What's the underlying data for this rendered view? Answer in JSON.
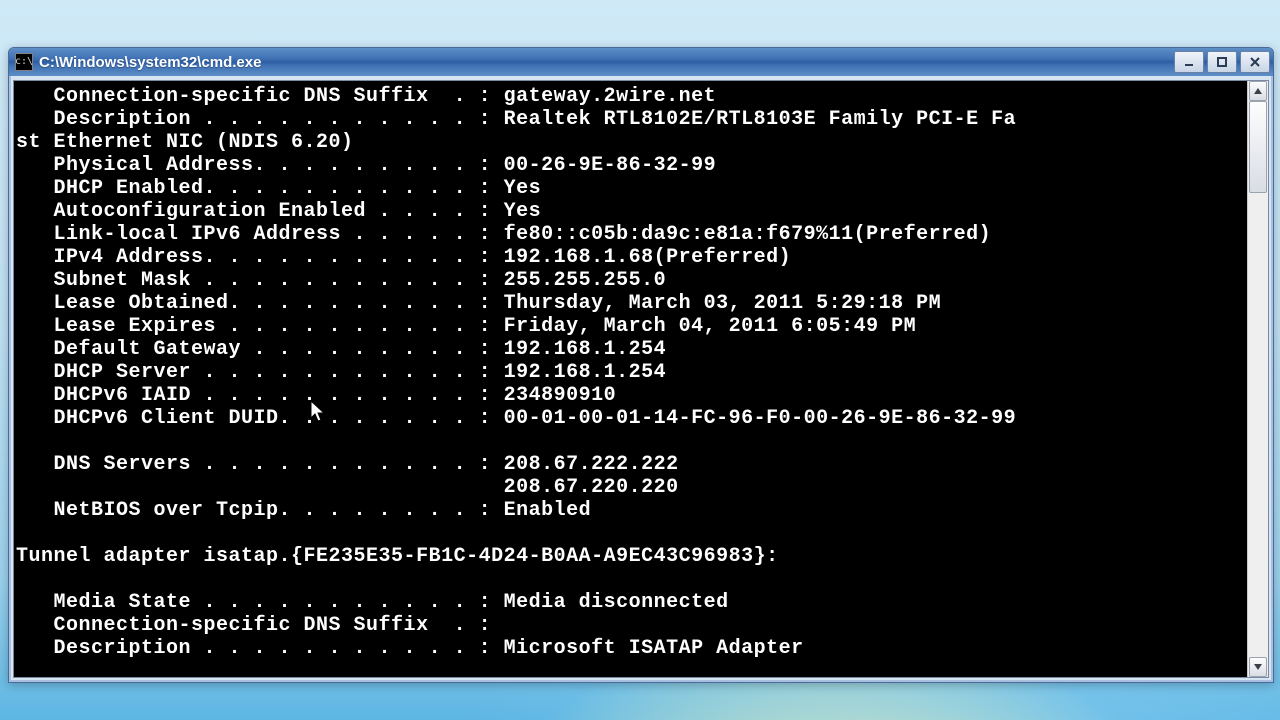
{
  "window": {
    "title": "C:\\Windows\\system32\\cmd.exe",
    "icon_label": "c:\\"
  },
  "adapter": {
    "dns_suffix": "gateway.2wire.net",
    "description": "Realtek RTL8102E/RTL8103E Family PCI-E Fast Ethernet NIC (NDIS 6.20)",
    "physical_address": "00-26-9E-86-32-99",
    "dhcp_enabled": "Yes",
    "autoconfig_enabled": "Yes",
    "link_local_ipv6": "fe80::c05b:da9c:e81a:f679%11(Preferred)",
    "ipv4_address": "192.168.1.68(Preferred)",
    "subnet_mask": "255.255.255.0",
    "lease_obtained": "Thursday, March 03, 2011 5:29:18 PM",
    "lease_expires": "Friday, March 04, 2011 6:05:49 PM",
    "default_gateway": "192.168.1.254",
    "dhcp_server": "192.168.1.254",
    "dhcpv6_iaid": "234890910",
    "dhcpv6_client_duid": "00-01-00-01-14-FC-96-F0-00-26-9E-86-32-99",
    "dns_server_1": "208.67.222.222",
    "dns_server_2": "208.67.220.220",
    "netbios": "Enabled"
  },
  "tunnel": {
    "heading": "Tunnel adapter isatap.{FE235E35-FB1C-4D24-B0AA-A9EC43C96983}:",
    "media_state": "Media disconnected",
    "dns_suffix": "",
    "description": "Microsoft ISATAP Adapter"
  },
  "lines": {
    "l1": "   Connection-specific DNS Suffix  . : ",
    "l2a": "   Description . . . . . . . . . . . : ",
    "l2b": "Realtek RTL8102E/RTL8103E Family PCI-E Fa",
    "l2c": "st Ethernet NIC (NDIS 6.20)",
    "l3": "   Physical Address. . . . . . . . . : ",
    "l4": "   DHCP Enabled. . . . . . . . . . . : ",
    "l5": "   Autoconfiguration Enabled . . . . : ",
    "l6": "   Link-local IPv6 Address . . . . . : ",
    "l7": "   IPv4 Address. . . . . . . . . . . : ",
    "l8": "   Subnet Mask . . . . . . . . . . . : ",
    "l9": "   Lease Obtained. . . . . . . . . . : ",
    "l10": "   Lease Expires . . . . . . . . . . : ",
    "l11": "   Default Gateway . . . . . . . . . : ",
    "l12": "   DHCP Server . . . . . . . . . . . : ",
    "l13": "   DHCPv6 IAID . . . . . . . . . . . : ",
    "l14": "   DHCPv6 Client DUID. . . . . . . . : ",
    "l15": "   DNS Servers . . . . . . . . . . . : ",
    "l15b": "                                       ",
    "l16": "   NetBIOS over Tcpip. . . . . . . . : ",
    "l18": "   Media State . . . . . . . . . . . : ",
    "l19": "   Connection-specific DNS Suffix  . : ",
    "l20": "   Description . . . . . . . . . . . : "
  }
}
